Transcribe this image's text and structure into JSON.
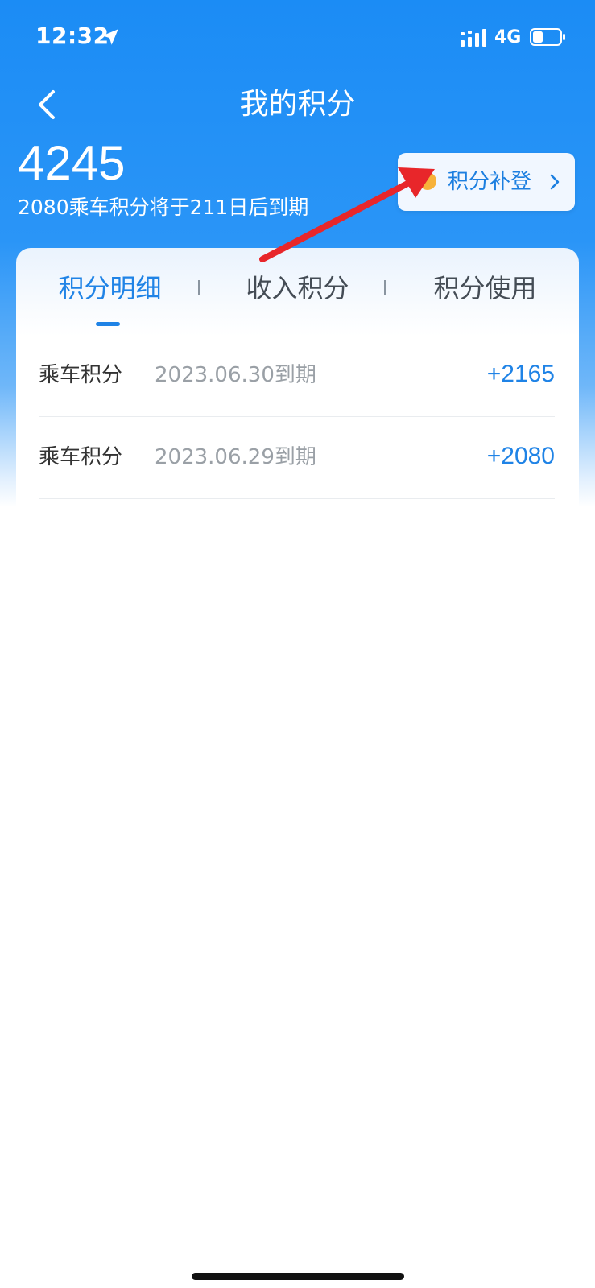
{
  "status_bar": {
    "time": "12:32",
    "network": "4G",
    "icons": [
      "location-arrow-icon",
      "signal-icon",
      "battery-icon"
    ]
  },
  "nav": {
    "title": "我的积分",
    "back_icon": "chevron-left-icon"
  },
  "summary": {
    "total_points": "4245",
    "expiry_note": "2080乘车积分将于211日后到期"
  },
  "makeup": {
    "label": "积分补登",
    "icon": "chevron-right-icon"
  },
  "tabs": [
    {
      "label": "积分明细",
      "active": true
    },
    {
      "label": "收入积分",
      "active": false
    },
    {
      "label": "积分使用",
      "active": false
    }
  ],
  "records": [
    {
      "type": "乘车积分",
      "expiry": "2023.06.30到期",
      "amount": "+2165"
    },
    {
      "type": "乘车积分",
      "expiry": "2023.06.29到期",
      "amount": "+2080"
    }
  ],
  "colors": {
    "header_blue": "#1b8cf5",
    "accent_blue": "#1f83e6",
    "annotation_red": "#e8262a"
  }
}
